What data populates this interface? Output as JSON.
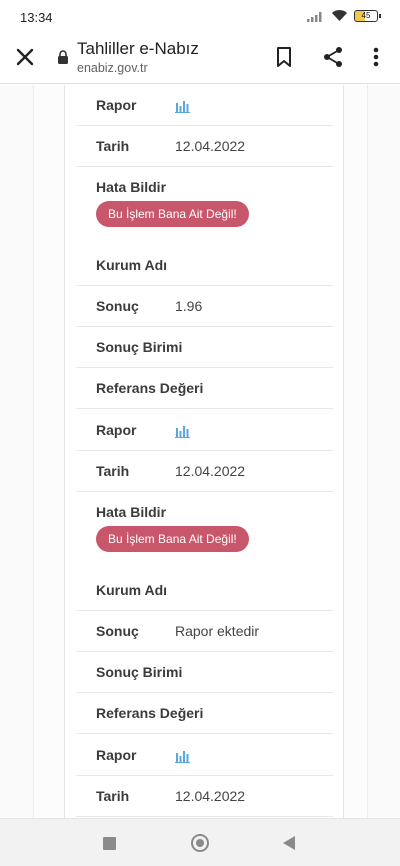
{
  "status": {
    "time": "13:34",
    "battery": "45"
  },
  "browser": {
    "title": "Tahliller e-Nabız",
    "url": "enabiz.gov.tr"
  },
  "labels": {
    "rapor": "Rapor",
    "tarih": "Tarih",
    "hata_bildir": "Hata Bildir",
    "kurum_adi": "Kurum Adı",
    "sonuc": "Sonuç",
    "sonuc_birimi": "Sonuç Birimi",
    "referans_degeri": "Referans Değeri",
    "error_button": "Bu İşlem Bana Ait Değil!"
  },
  "values": {
    "tarih_1": "12.04.2022",
    "sonuc_1": "1.96",
    "tarih_2": "12.04.2022",
    "sonuc_2": "Rapor ektedir",
    "tarih_3": "12.04.2022"
  },
  "colors": {
    "error_button": "#c9576b",
    "chart_icon": "#5aa7e0"
  },
  "icons": [
    "close-icon",
    "lock-icon",
    "bookmark-icon",
    "share-icon",
    "more-vert-icon",
    "bar-chart-icon",
    "wifi-icon",
    "signal-icon",
    "battery-icon"
  ]
}
